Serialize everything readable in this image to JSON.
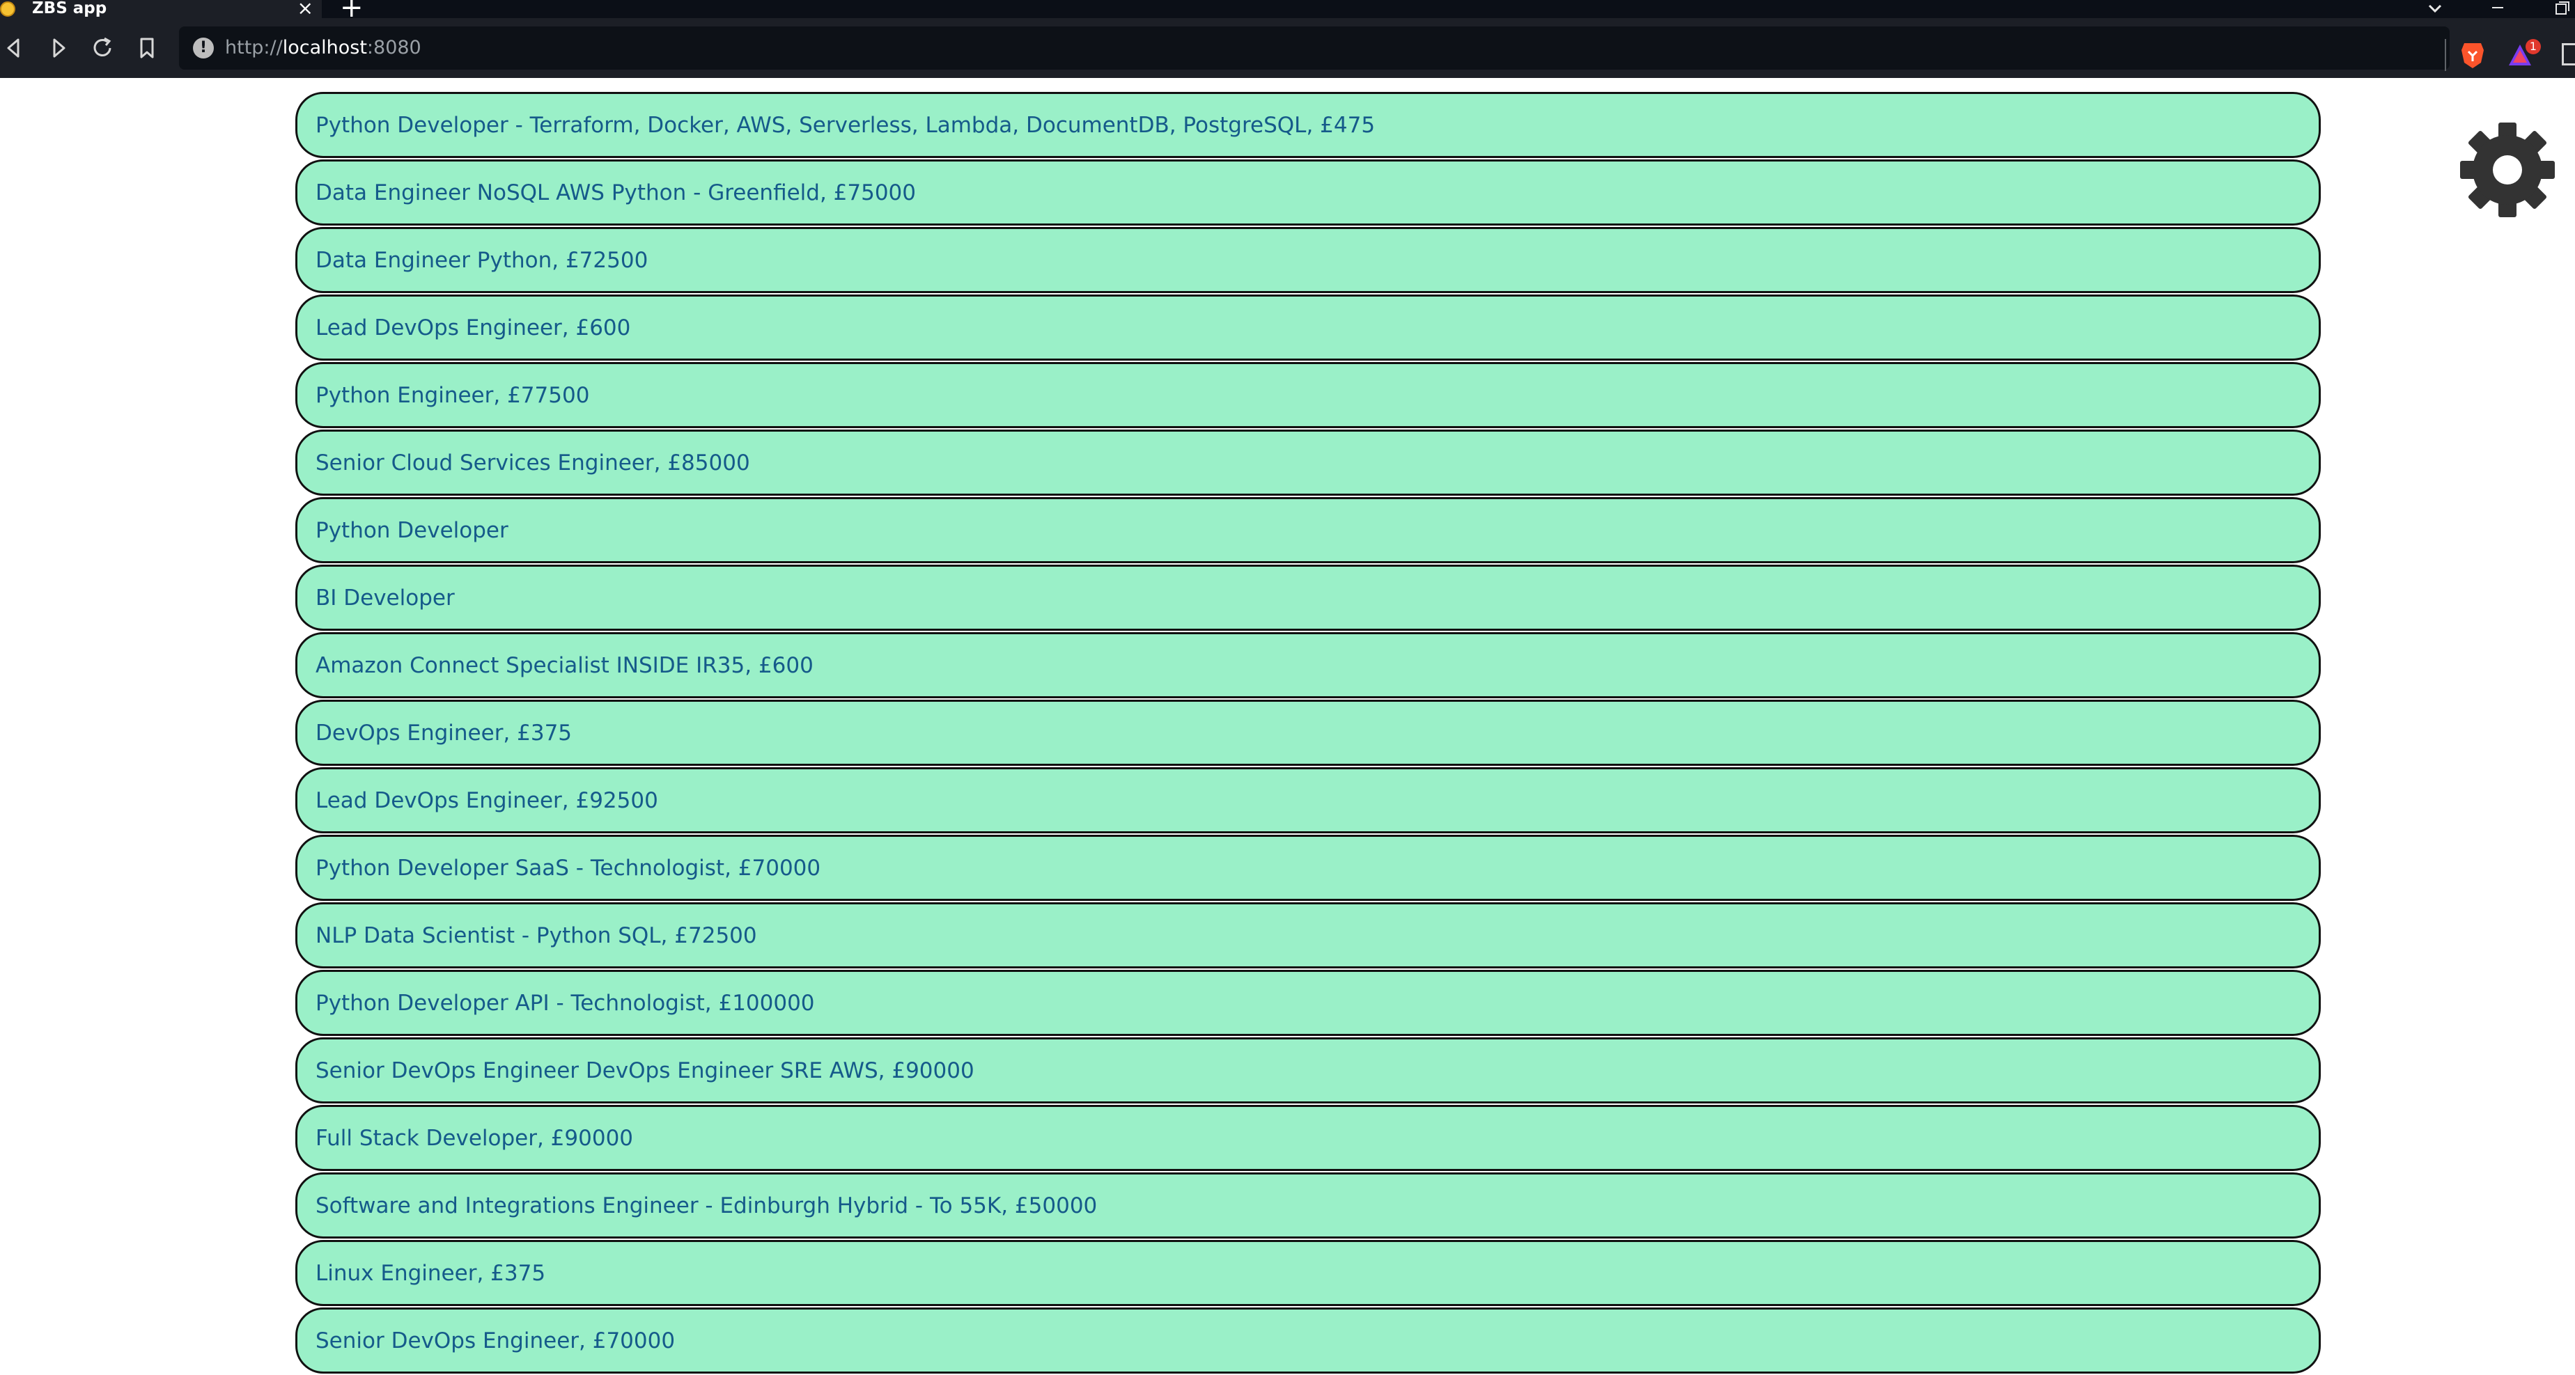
{
  "browser": {
    "tab_title": "ZBS app",
    "tab_close": "×",
    "new_tab": "+",
    "url_scheme": "http://",
    "url_host": "localhost",
    "url_port": ":8080",
    "rewards_badge": "1",
    "icons": {
      "back": "back-arrow-icon",
      "forward": "forward-arrow-icon",
      "reload": "reload-icon",
      "bookmark": "bookmark-icon",
      "site_info": "info-icon",
      "brave_shields": "brave-lion-icon",
      "rewards": "rewards-triangle-icon",
      "tab_search": "chevron-down-icon",
      "minimize": "minimize-icon",
      "restore": "restore-icon"
    }
  },
  "colors": {
    "item_background": "#9af0c8",
    "item_border": "#111111",
    "item_text": "#155a8a",
    "settings_icon": "#333333"
  },
  "jobs": [
    "Python Developer - Terraform, Docker, AWS, Serverless, Lambda, DocumentDB, PostgreSQL, £475",
    "Data Engineer NoSQL AWS Python - Greenfield, £75000",
    "Data Engineer Python, £72500",
    "Lead DevOps Engineer, £600",
    "Python Engineer, £77500",
    "Senior Cloud Services Engineer, £85000",
    "Python Developer",
    "BI Developer",
    "Amazon Connect Specialist INSIDE IR35, £600",
    "DevOps Engineer, £375",
    "Lead DevOps Engineer, £92500",
    "Python Developer SaaS - Technologist, £70000",
    "NLP Data Scientist - Python SQL, £72500",
    "Python Developer API - Technologist, £100000",
    "Senior DevOps Engineer DevOps Engineer SRE AWS, £90000",
    "Full Stack Developer, £90000",
    "Software and Integrations Engineer - Edinburgh Hybrid - To 55K, £50000",
    "Linux Engineer, £375",
    "Senior DevOps Engineer, £70000"
  ],
  "settings": {
    "icon": "gear-icon"
  }
}
